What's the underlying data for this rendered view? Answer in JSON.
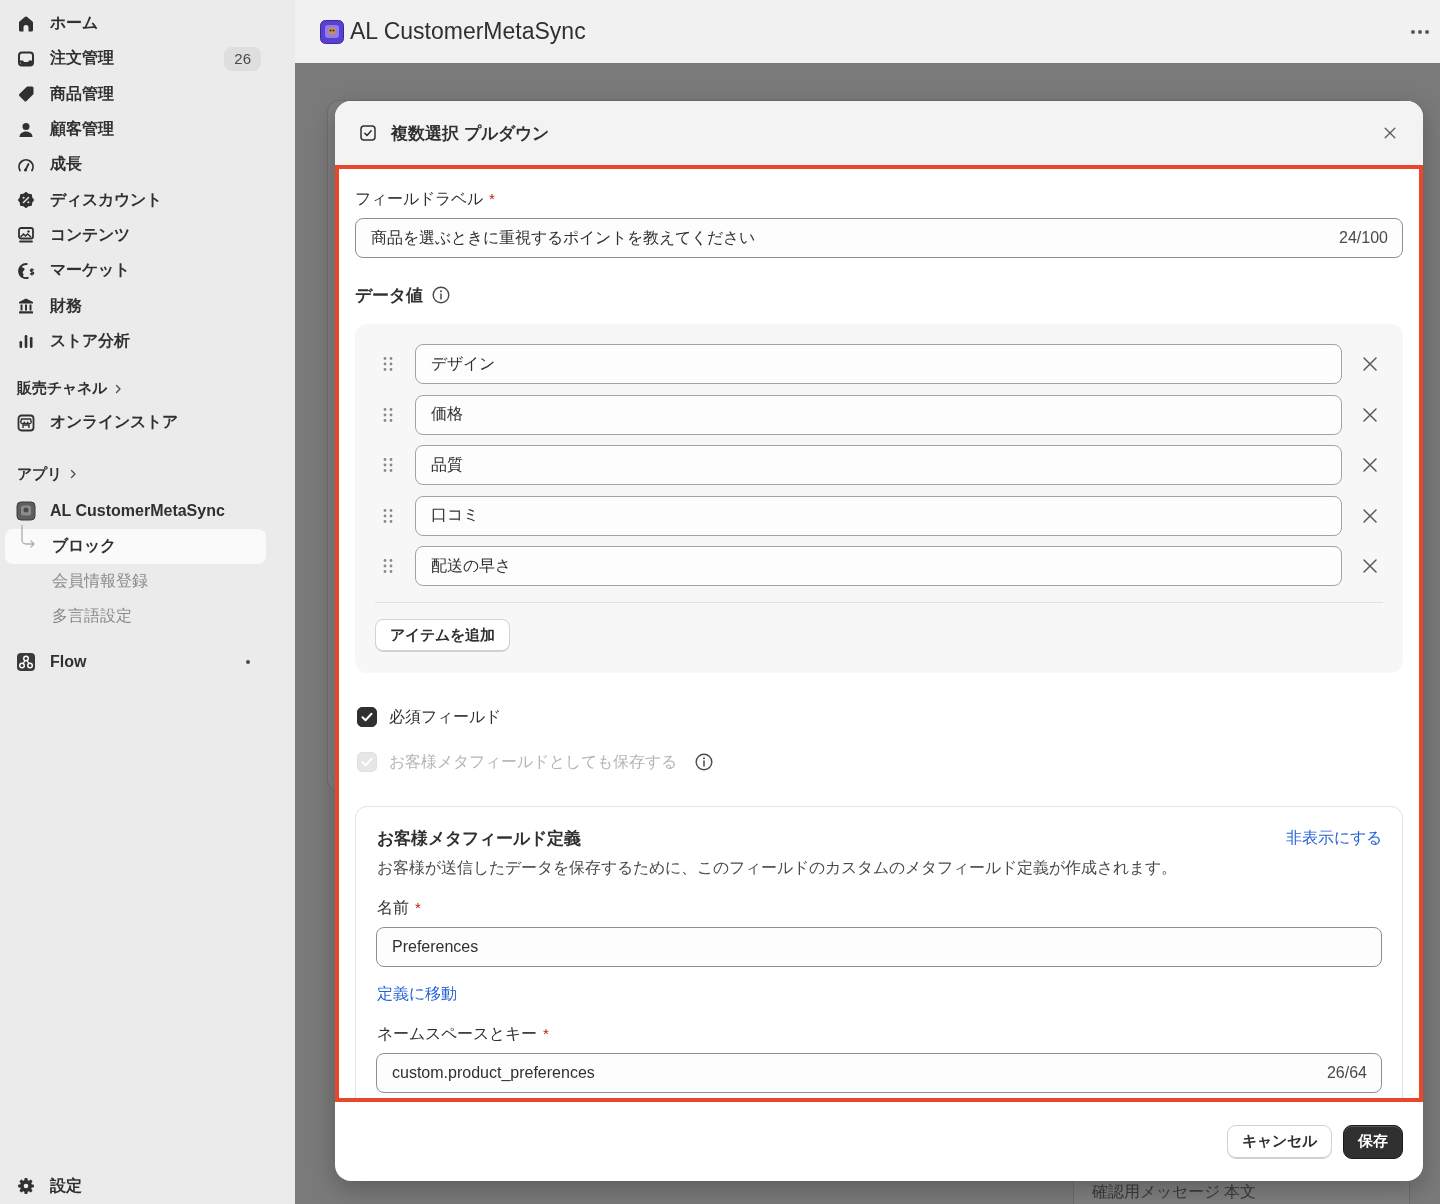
{
  "sidebar": {
    "nav_items": [
      {
        "label": "ホーム",
        "selected": false
      },
      {
        "label": "注文管理",
        "badge": "26",
        "selected": false
      },
      {
        "label": "商品管理",
        "selected": false
      },
      {
        "label": "顧客管理",
        "selected": false
      },
      {
        "label": "成長",
        "selected": false
      },
      {
        "label": "ディスカウント",
        "selected": false
      },
      {
        "label": "コンテンツ",
        "selected": false
      },
      {
        "label": "マーケット",
        "selected": false
      },
      {
        "label": "財務",
        "selected": false
      },
      {
        "label": "ストア分析",
        "selected": false
      }
    ],
    "sales_channels": {
      "heading": "販売チャネル",
      "items": [
        {
          "label": "オンラインストア",
          "selected": false
        }
      ]
    },
    "apps": {
      "heading": "アプリ",
      "items": [
        {
          "label": "AL CustomerMetaSync",
          "selected": false,
          "dot": false,
          "children": [
            {
              "label": "ブロック",
              "selected": true
            },
            {
              "label": "会員情報登録",
              "selected": false
            },
            {
              "label": "多言語設定",
              "selected": false
            }
          ]
        },
        {
          "label": "Flow",
          "selected": false,
          "dot": true
        }
      ]
    },
    "settings": {
      "label": "設定"
    }
  },
  "header": {
    "title": "AL CustomerMetaSync"
  },
  "background_page": {
    "field_label": "確認用メッセージ 本文"
  },
  "modal": {
    "title": "複数選択 プルダウン",
    "field_label": {
      "label": "フィールドラベル",
      "required_mark": "*",
      "value": "商品を選ぶときに重視するポイントを教えてください",
      "counter": "24/100"
    },
    "data_values": {
      "heading": "データ値",
      "items": [
        "デザイン",
        "価格",
        "品質",
        "口コミ",
        "配送の早さ"
      ],
      "add_button": "アイテムを追加"
    },
    "checkboxes": [
      {
        "label": "必須フィールド",
        "checked": true,
        "disabled": false,
        "info": false
      },
      {
        "label": "お客様メタフィールドとしても保存する",
        "checked": true,
        "disabled": true,
        "info": true
      }
    ],
    "metafield_card": {
      "title": "お客様メタフィールド定義",
      "hide_link": "非表示にする",
      "description": "お客様が送信したデータを保存するために、このフィールドのカスタムのメタフィールド定義が作成されます。",
      "name_field": {
        "label": "名前",
        "required_mark": "*",
        "value": "Preferences"
      },
      "definition_link": "定義に移動",
      "key_field": {
        "label": "ネームスペースとキー",
        "required_mark": "*",
        "value": "custom.product_preferences",
        "counter": "26/64"
      }
    },
    "buttons": [
      {
        "label": "キャンセル",
        "kind": "secondary"
      },
      {
        "label": "保存",
        "kind": "primary"
      }
    ]
  }
}
